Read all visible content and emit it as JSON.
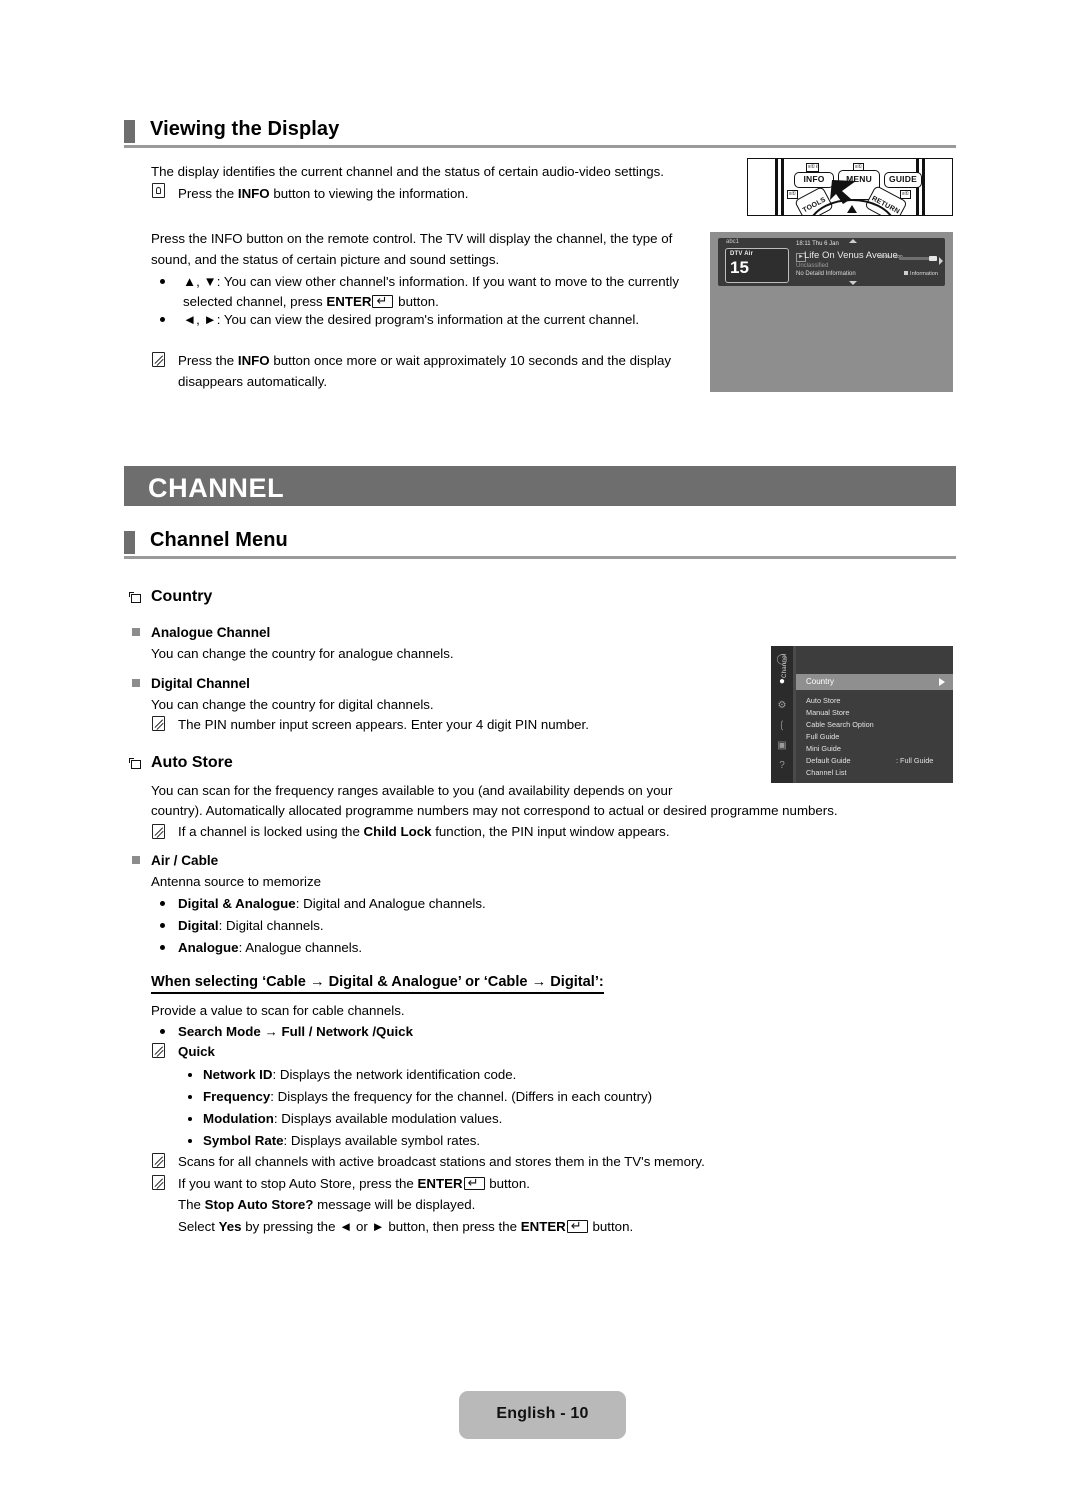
{
  "sections": {
    "viewing": {
      "title": "Viewing the Display",
      "intro": "The display identifies the current channel and the status of certain audio-video settings.",
      "press_note": "Press the INFO button to viewing the information.",
      "para1_l1": "Press the INFO button on the remote control. The TV will display the channel, the type of",
      "para1_l2": "sound, and the status of certain picture and sound settings.",
      "bullet1_l1": "▲, ▼: You can view other channel's information. If you want to move to the currently",
      "bullet1_l2_a": "selected channel, press ",
      "bullet1_l2_b": "ENTER",
      "bullet1_l2_c": " button.",
      "bullet2": "◄, ►: You can view the desired program's information at the current channel.",
      "note1_l1": "Press the INFO button once more or wait approximately 10 seconds and the display",
      "note1_l2": "disappears automatically."
    },
    "band_title": "CHANNEL",
    "channel_menu": {
      "title": "Channel Menu",
      "country": {
        "heading": "Country",
        "analogue_heading": "Analogue Channel",
        "analogue_text": "You can change the country for analogue channels.",
        "digital_heading": "Digital Channel",
        "digital_text": "You can change the country for digital channels.",
        "digital_note": "The PIN number input screen appears. Enter your 4 digit PIN number."
      },
      "auto_store": {
        "heading": "Auto Store",
        "text_l1": "You can scan for the frequency ranges available to you (and availability depends on your",
        "text_l2": "country). Automatically allocated programme numbers may not correspond to actual or desired programme numbers.",
        "note": "If a channel is locked using the Child Lock function, the PIN input window appears.",
        "air_cable_heading": "Air / Cable",
        "air_cable_text": "Antenna source to memorize",
        "options": [
          {
            "name": "Digital & Analogue",
            "desc": ": Digital and Analogue channels."
          },
          {
            "name": "Digital",
            "desc": ": Digital channels."
          },
          {
            "name": "Analogue",
            "desc": ": Analogue channels."
          }
        ]
      },
      "cable": {
        "heading": "When selecting ‘Cable → Digital & Analogue’ or ‘Cable → Digital’:",
        "intro": "Provide a value to scan for cable channels.",
        "search_mode": "Search Mode → Full / Network /Quick",
        "quick_label": "Quick",
        "quick_items": [
          {
            "name": "Network ID",
            "desc": ": Displays the network identification code."
          },
          {
            "name": "Frequency",
            "desc": ": Displays the frequency for the channel. (Differs in each country)"
          },
          {
            "name": "Modulation",
            "desc": ": Displays available modulation values."
          },
          {
            "name": "Symbol Rate",
            "desc": ": Displays available symbol rates."
          }
        ],
        "note_scan": "Scans for all channels with active broadcast stations and stores them in the TV's memory.",
        "note_stop_a": "If you want to stop Auto Store, press the ",
        "note_stop_b": "ENTER",
        "note_stop_c": " button.",
        "note_msg_a": "The ",
        "note_msg_b": "Stop Auto Store?",
        "note_msg_c": " message will be displayed.",
        "note_sel_a": "Select ",
        "note_sel_b": "Yes",
        "note_sel_c": " by pressing the ◄ or ► button, then press the ",
        "note_sel_d": "ENTER",
        "note_sel_e": " button."
      }
    }
  },
  "remote": {
    "info_label": "INFO",
    "menu_label": "MENU",
    "guide_label": "GUIDE",
    "tools_label": "TOOLS",
    "return_label": "RETURN",
    "tag_info": "≡① ℓ",
    "tag_menu": "≡①",
    "tag_tools": "≡①",
    "tag_return": "≡①"
  },
  "tv_display": {
    "station": "abc1",
    "source": "DTV Air",
    "channel_number": "15",
    "datetime": "18:11 Thu 6 Jan",
    "programme": "Life On Venus Avenue",
    "rating": "Unclassified",
    "detail": "No Detaild Information",
    "timespan": "18:00 - 0:00",
    "info_label": "Information"
  },
  "tv_menu": {
    "vertical_label": "Channel",
    "selected": "Country",
    "items": [
      {
        "label": "Auto Store",
        "value": ""
      },
      {
        "label": "Manual Store",
        "value": ""
      },
      {
        "label": "Cable Search Option",
        "value": ""
      },
      {
        "label": "Full Guide",
        "value": ""
      },
      {
        "label": "Mini Guide",
        "value": ""
      },
      {
        "label": "Default Guide",
        "value": ": Full Guide"
      },
      {
        "label": "Channel List",
        "value": ""
      }
    ]
  },
  "footer": {
    "page_label": "English - 10"
  },
  "colors": {
    "band_gray": "#6e6e6e",
    "rule_gray": "#9a9a9a",
    "footer_gray": "#b9b9b9",
    "tv_bg": "#8e8e8e",
    "menu_bg": "#3d3d3d"
  }
}
